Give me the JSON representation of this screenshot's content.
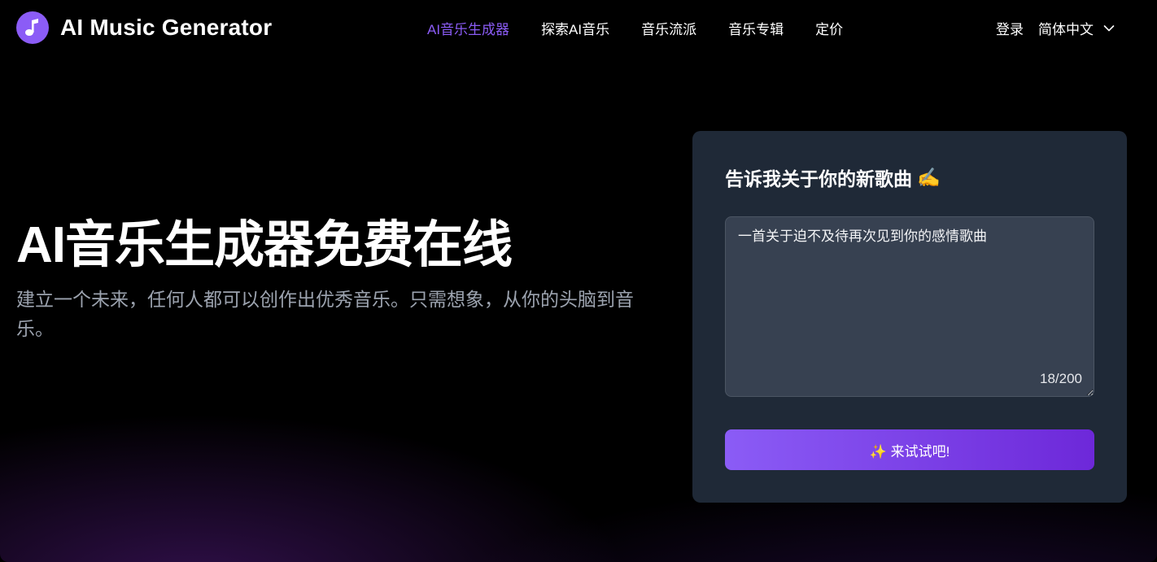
{
  "header": {
    "app_name": "AI Music Generator",
    "nav": [
      {
        "label": "AI音乐生成器",
        "active": true
      },
      {
        "label": "探索AI音乐",
        "active": false
      },
      {
        "label": "音乐流派",
        "active": false
      },
      {
        "label": "音乐专辑",
        "active": false
      },
      {
        "label": "定价",
        "active": false
      }
    ],
    "login_label": "登录",
    "language": "简体中文"
  },
  "hero": {
    "title": "AI音乐生成器免费在线",
    "subtitle": "建立一个未来，任何人都可以创作出优秀音乐。只需想象，从你的头脑到音乐。"
  },
  "card": {
    "title": "告诉我关于你的新歌曲",
    "title_emoji": "✍️",
    "prompt_value": "一首关于迫不及待再次见到你的感情歌曲",
    "char_count": "18/200",
    "button_label": "✨ 来试试吧!"
  },
  "colors": {
    "accent": "#8b5cf6",
    "card_bg": "#1f2937",
    "input_bg": "#374151",
    "subtitle": "#9ca3af"
  },
  "icons": {
    "logo": "music-note-icon",
    "language": "chevron-down-icon"
  }
}
